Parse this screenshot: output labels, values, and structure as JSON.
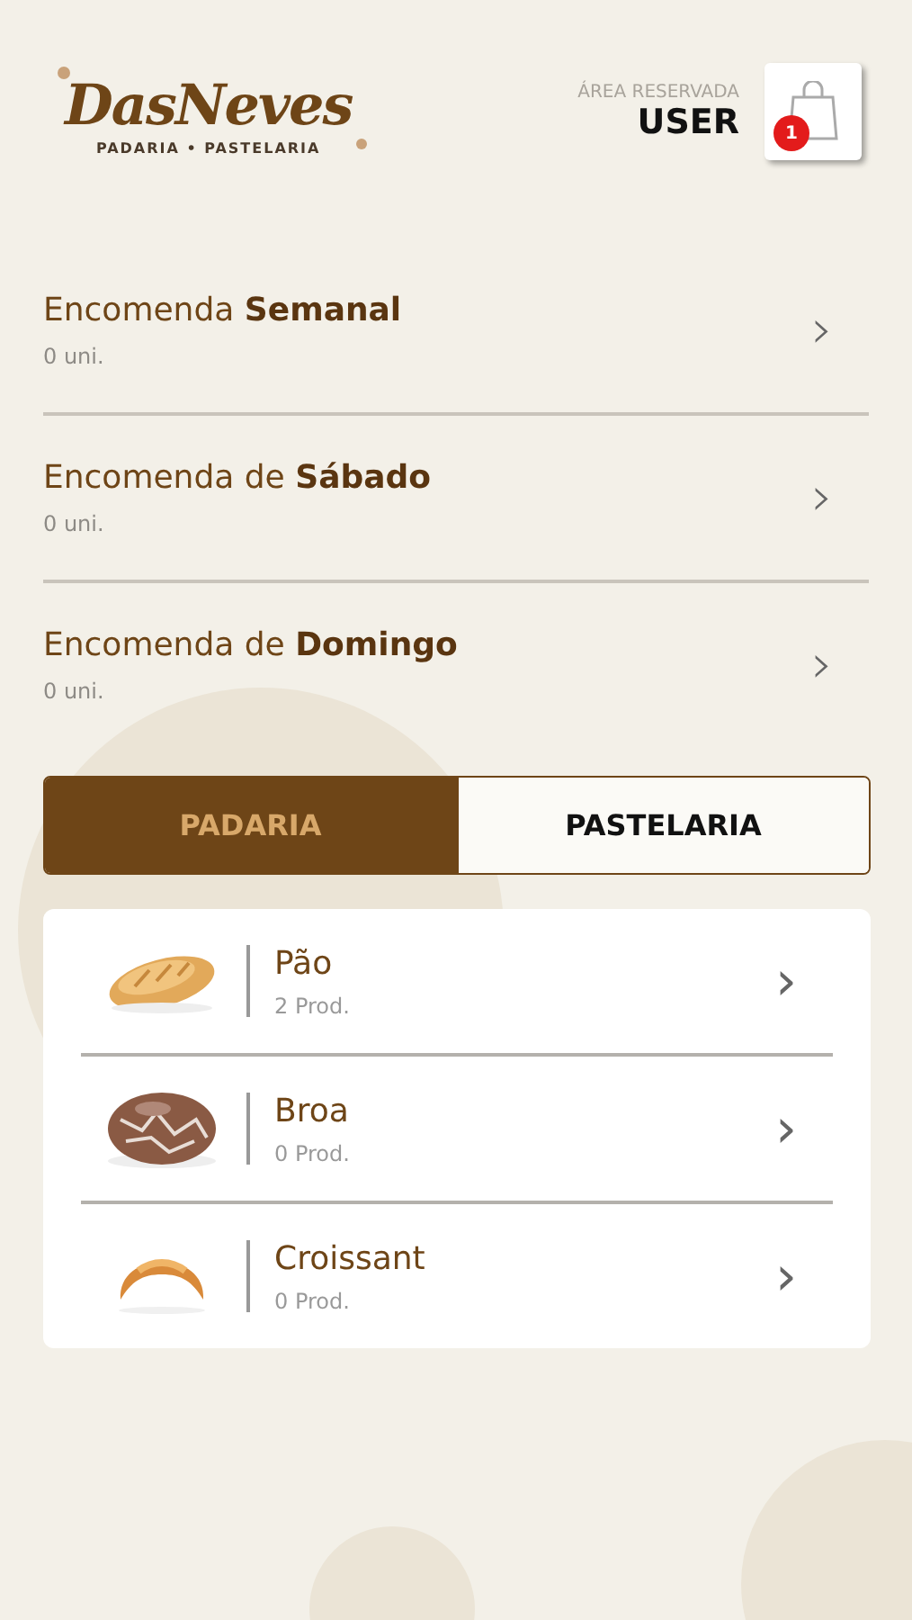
{
  "header": {
    "logo": {
      "name": "DasNeves",
      "tagline": "PADARIA • PASTELARIA"
    },
    "area_label": "ÁREA RESERVADA",
    "user": "USER",
    "cart_count": "1"
  },
  "orders": [
    {
      "title": "Encomenda **Semanal**",
      "count": "0 uni.",
      "chevron": "›"
    },
    {
      "title": "Encomenda de **Sábado**",
      "count": "0 uni.",
      "chevron": "›"
    },
    {
      "title": "Encomenda de **Domingo**",
      "count": "0 uni.",
      "chevron": "›"
    }
  ],
  "tabs": [
    {
      "label": "PADARIA",
      "selected": true
    },
    {
      "label": "PASTELARIA",
      "selected": false
    }
  ],
  "categories": [
    {
      "name": "Pão",
      "count": "2 Prod.",
      "chevron": "›"
    },
    {
      "name": "Broa",
      "count": "0 Prod.",
      "chevron": "›"
    },
    {
      "name": "Croissant",
      "count": "0 Prod.",
      "chevron": "›"
    }
  ]
}
